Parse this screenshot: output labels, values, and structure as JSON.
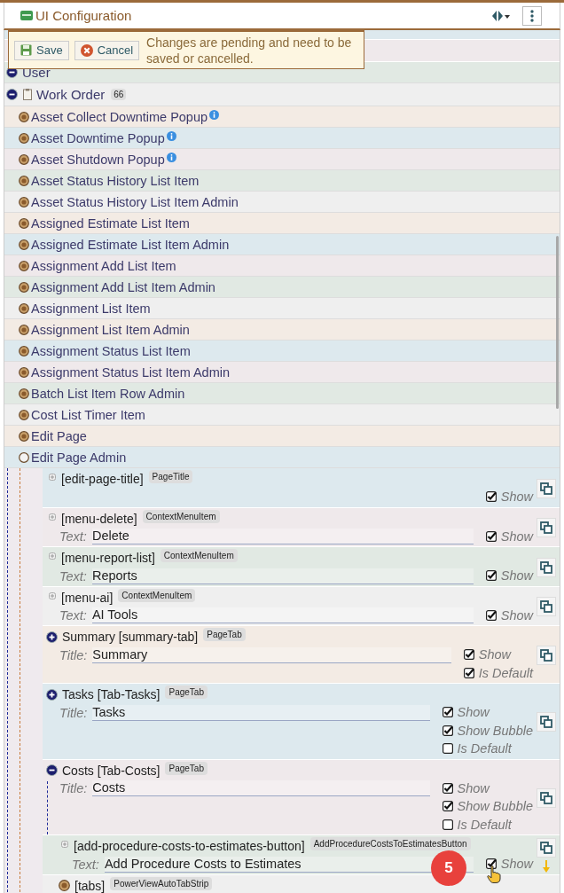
{
  "header": {
    "title": "UI Configuration"
  },
  "notice": {
    "buttons": [
      {
        "kind": "save",
        "label": "Save"
      },
      {
        "kind": "cancel",
        "label": "Cancel"
      }
    ],
    "message": "Changes are pending and need to be saved or cancelled."
  },
  "groups": [
    {
      "label": "User",
      "expanded": true
    },
    {
      "label": "Work Order",
      "expanded": true,
      "count": "66",
      "items": [
        {
          "label": "Asset Collect Downtime Popup",
          "info": true,
          "expanded": false
        },
        {
          "label": "Asset Downtime Popup",
          "info": true,
          "expanded": false
        },
        {
          "label": "Asset Shutdown Popup",
          "info": true,
          "expanded": false
        },
        {
          "label": "Asset Status History List Item",
          "info": false,
          "expanded": false
        },
        {
          "label": "Asset Status History List Item Admin",
          "info": false,
          "expanded": false
        },
        {
          "label": "Assigned Estimate List Item",
          "info": false,
          "expanded": false
        },
        {
          "label": "Assigned Estimate List Item Admin",
          "info": false,
          "expanded": false
        },
        {
          "label": "Assignment Add List Item",
          "info": false,
          "expanded": false
        },
        {
          "label": "Assignment Add List Item Admin",
          "info": false,
          "expanded": false
        },
        {
          "label": "Assignment List Item",
          "info": false,
          "expanded": false
        },
        {
          "label": "Assignment List Item Admin",
          "info": false,
          "expanded": false
        },
        {
          "label": "Assignment Status List Item",
          "info": false,
          "expanded": false
        },
        {
          "label": "Assignment Status List Item Admin",
          "info": false,
          "expanded": false
        },
        {
          "label": "Batch List Item Row Admin",
          "info": false,
          "expanded": false
        },
        {
          "label": "Cost List Timer Item",
          "info": false,
          "expanded": false
        },
        {
          "label": "Edit Page",
          "info": false,
          "expanded": false
        },
        {
          "label": "Edit Page Admin",
          "info": false,
          "expanded": true,
          "elements": [
            {
              "kind": "element",
              "name": "[edit-page-title]",
              "type": "PageTitle",
              "expanded": false,
              "options": [
                {
                  "label": "Show",
                  "checked": true
                }
              ]
            },
            {
              "kind": "element",
              "name": "[menu-delete]",
              "type": "ContextMenuItem",
              "expanded": false,
              "field": {
                "label": "Text:",
                "value": "Delete"
              },
              "options": [
                {
                  "label": "Show",
                  "checked": true
                }
              ]
            },
            {
              "kind": "element",
              "name": "[menu-report-list]",
              "type": "ContextMenuItem",
              "expanded": false,
              "field": {
                "label": "Text:",
                "value": "Reports"
              },
              "options": [
                {
                  "label": "Show",
                  "checked": true
                }
              ]
            },
            {
              "kind": "element",
              "name": "[menu-ai]",
              "type": "ContextMenuItem",
              "expanded": false,
              "field": {
                "label": "Text:",
                "value": "AI Tools"
              },
              "options": [
                {
                  "label": "Show",
                  "checked": true
                }
              ]
            },
            {
              "kind": "tab",
              "name": "Summary [summary-tab]",
              "type": "PageTab",
              "expanded": false,
              "field": {
                "label": "Title:",
                "value": "Summary"
              },
              "options": [
                {
                  "label": "Show",
                  "checked": true
                },
                {
                  "label": "Is Default",
                  "checked": true
                }
              ]
            },
            {
              "kind": "tab",
              "name": "Tasks [Tab-Tasks]",
              "type": "PageTab",
              "expanded": false,
              "field": {
                "label": "Title:",
                "value": "Tasks"
              },
              "options": [
                {
                  "label": "Show",
                  "checked": true
                },
                {
                  "label": "Show Bubble",
                  "checked": true
                },
                {
                  "label": "Is Default",
                  "checked": false
                }
              ]
            },
            {
              "kind": "tab",
              "name": "Costs [Tab-Costs]",
              "type": "PageTab",
              "expanded": true,
              "field": {
                "label": "Title:",
                "value": "Costs"
              },
              "options": [
                {
                  "label": "Show",
                  "checked": true
                },
                {
                  "label": "Show Bubble",
                  "checked": true
                },
                {
                  "label": "Is Default",
                  "checked": false
                }
              ],
              "children": [
                {
                  "kind": "element",
                  "name": "[add-procedure-costs-to-estimates-button]",
                  "type": "AddProcedureCostsToEstimatesButton",
                  "expanded": false,
                  "moved": true,
                  "field": {
                    "label": "Text:",
                    "value": "Add Procedure Costs to Estimates"
                  },
                  "options": [
                    {
                      "label": "Show",
                      "checked": true
                    }
                  ]
                },
                {
                  "kind": "component",
                  "name": "[tabs]",
                  "type": "PowerViewAutoTabStrip"
                }
              ]
            }
          ]
        }
      ]
    }
  ],
  "overlay_badge": "5"
}
